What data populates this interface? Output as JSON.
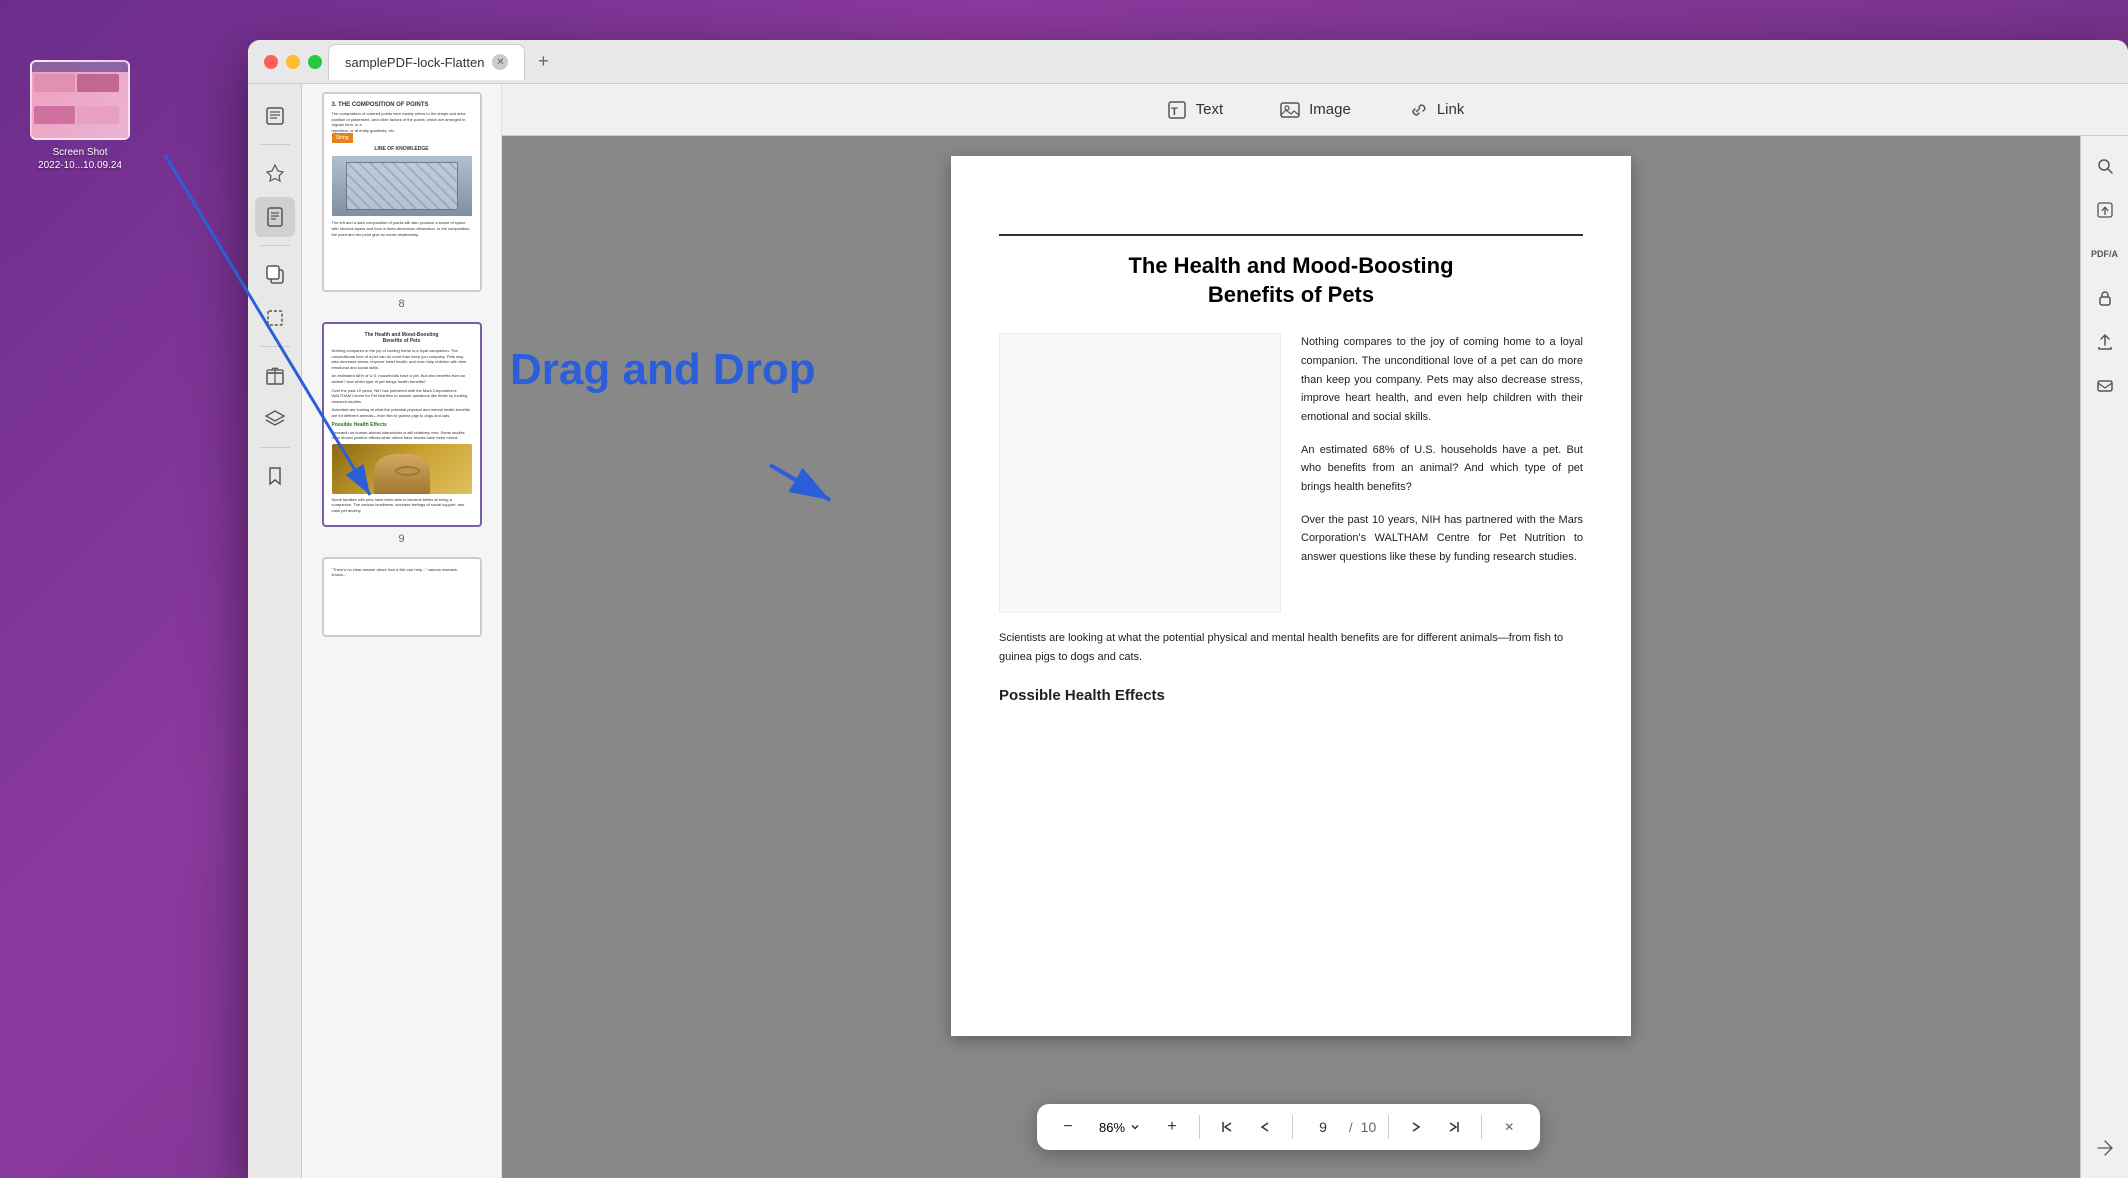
{
  "window": {
    "title": "samplePDF-lock-Flatten",
    "tab_label": "samplePDF-lock-Flatten"
  },
  "toolbar": {
    "text_label": "Text",
    "image_label": "Image",
    "link_label": "Link"
  },
  "pdf": {
    "title": "The Health and Mood-Boosting\nBenefits of Pets",
    "page_current": "9",
    "page_total": "10",
    "zoom": "86%",
    "paragraph1": "Nothing compares to the joy of coming home to a loyal companion. The unconditional love of a pet can do more than keep you company. Pets may also decrease stress, improve heart health, and  even  help children  with  their emotional and social skills.",
    "paragraph2": "An estimated 68% of U.S. households have a pet. But who benefits from an animal? And which type of pet brings health benefits?",
    "paragraph3": "Over  the  past  10  years,  NIH  has partnered with the Mars Corporation's WALTHAM Centre for  Pet  Nutrition  to answer  questions  like these by funding research studies.",
    "bottom_text": "Scientists are looking at what the potential physical and mental health benefits are for different animals—from fish to guinea pigs to dogs and cats.",
    "possible_health_effects": "Possible Health Effects",
    "possible_health_text": "Research on human-animal interactions is still relatively new. Some studies have shown positive effects while others have results have been mixed.",
    "drag_drop_label": "Drag and Drop"
  },
  "thumbnail8": {
    "label": "8",
    "composition_title": "3. THE COMPOSITION OF POINTS",
    "orange_label": "String",
    "line_of_knowledge": "LINE OF KNOWLEDGE"
  },
  "thumbnail9": {
    "label": "9",
    "title": "The Health and Mood-Boosting\nBenefits of Pets"
  },
  "screenshot": {
    "label1": "Screen Shot",
    "label2": "2022-10...10.09.24"
  },
  "navigation": {
    "zoom_minus": "−",
    "zoom_plus": "+",
    "first_page": "⇤",
    "prev_page": "↑",
    "next_page": "↓",
    "last_page": "⇥",
    "close": "✕"
  },
  "sidebar_icons": [
    "📋",
    "🔖",
    "📄",
    "📑",
    "🔲",
    "🎁",
    "📚",
    "🔖"
  ],
  "right_toolbar_icons": [
    "🔍",
    "📷",
    "PDF/A",
    "🔒",
    "⬆",
    "✉"
  ],
  "colors": {
    "accent_purple": "#7b5ea7",
    "drag_drop_blue": "#2b5fd9",
    "arrow_blue": "#2b5fd9",
    "orange": "#e8821c",
    "green": "#2d6e2d"
  }
}
